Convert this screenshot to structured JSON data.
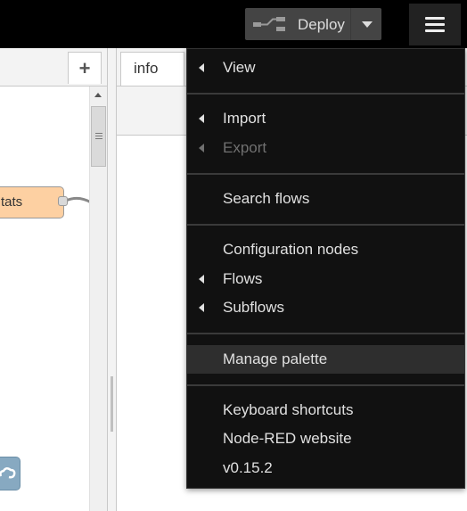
{
  "header": {
    "deploy": {
      "label": "Deploy",
      "icon": "deploy-icon"
    },
    "menu_icon": "hamburger-menu-icon"
  },
  "workspace": {
    "add_tab": "+",
    "node_label": "tats"
  },
  "sidebar": {
    "tab_label": "info"
  },
  "menu": {
    "view": "View",
    "import": "Import",
    "export": "Export",
    "search": "Search flows",
    "config_nodes": "Configuration nodes",
    "flows": "Flows",
    "subflows": "Subflows",
    "manage_palette": "Manage palette",
    "keyboard": "Keyboard shortcuts",
    "website": "Node-RED website",
    "version": "v0.15.2"
  },
  "colors": {
    "header_bg": "#000000",
    "menu_bg": "#111111",
    "menu_highlight": "#2e2e2e",
    "node_fill": "#fdd0a2",
    "node2_fill": "#87a9c1"
  }
}
